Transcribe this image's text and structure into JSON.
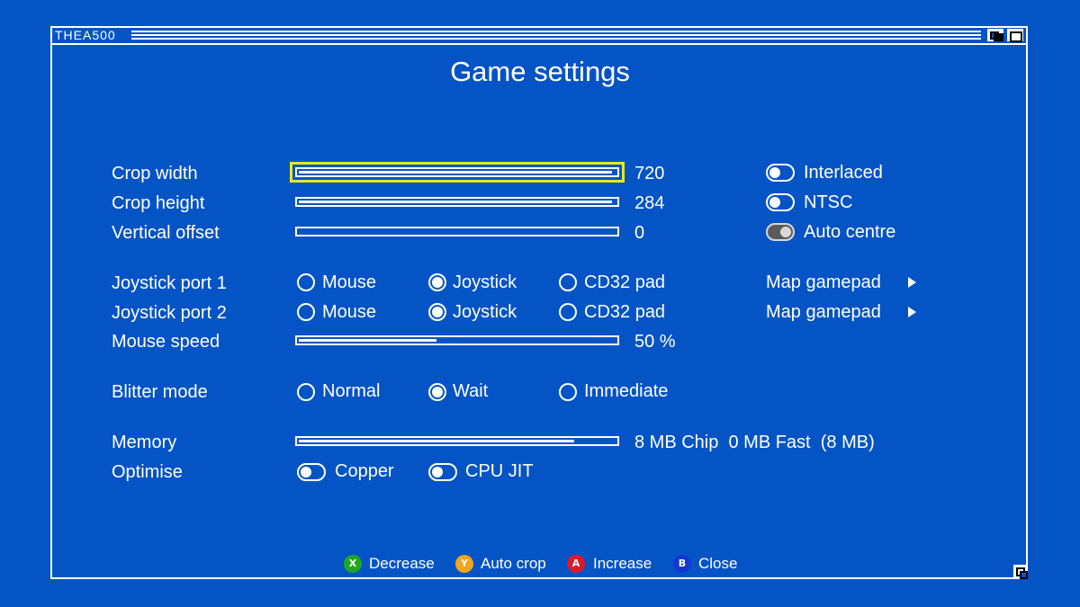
{
  "window": {
    "title": "THEA500"
  },
  "page": {
    "title": "Game settings"
  },
  "display": {
    "crop_width": {
      "label": "Crop width",
      "value": "720",
      "fill": 0.99
    },
    "crop_height": {
      "label": "Crop height",
      "value": "284",
      "fill": 0.99
    },
    "vertical_offset": {
      "label": "Vertical offset",
      "value": "0",
      "fill": 0.0
    },
    "interlaced": {
      "label": "Interlaced",
      "on": false
    },
    "ntsc": {
      "label": "NTSC",
      "on": false
    },
    "auto_centre": {
      "label": "Auto centre",
      "on": true
    }
  },
  "input": {
    "port1": {
      "label": "Joystick port 1",
      "options": [
        "Mouse",
        "Joystick",
        "CD32 pad"
      ],
      "selected": "Joystick",
      "map_label": "Map gamepad"
    },
    "port2": {
      "label": "Joystick port 2",
      "options": [
        "Mouse",
        "Joystick",
        "CD32 pad"
      ],
      "selected": "Joystick",
      "map_label": "Map gamepad"
    },
    "mouse_speed": {
      "label": "Mouse speed",
      "value": "50 %",
      "fill": 0.44
    }
  },
  "blitter": {
    "label": "Blitter mode",
    "options": [
      "Normal",
      "Wait",
      "Immediate"
    ],
    "selected": "Wait"
  },
  "memory": {
    "label": "Memory",
    "value": "8 MB Chip  0 MB Fast  (8 MB)",
    "fill": 0.87
  },
  "optimise": {
    "label": "Optimise",
    "copper": "Copper",
    "cpu_jit": "CPU JIT"
  },
  "footer": {
    "x": {
      "glyph": "X",
      "label": "Decrease",
      "color": "#1fa81f"
    },
    "y": {
      "glyph": "Y",
      "label": "Auto crop",
      "color": "#f0a51c"
    },
    "a": {
      "glyph": "A",
      "label": "Increase",
      "color": "#e0182d"
    },
    "b": {
      "glyph": "B",
      "label": "Close",
      "color": "#1237d6"
    }
  }
}
